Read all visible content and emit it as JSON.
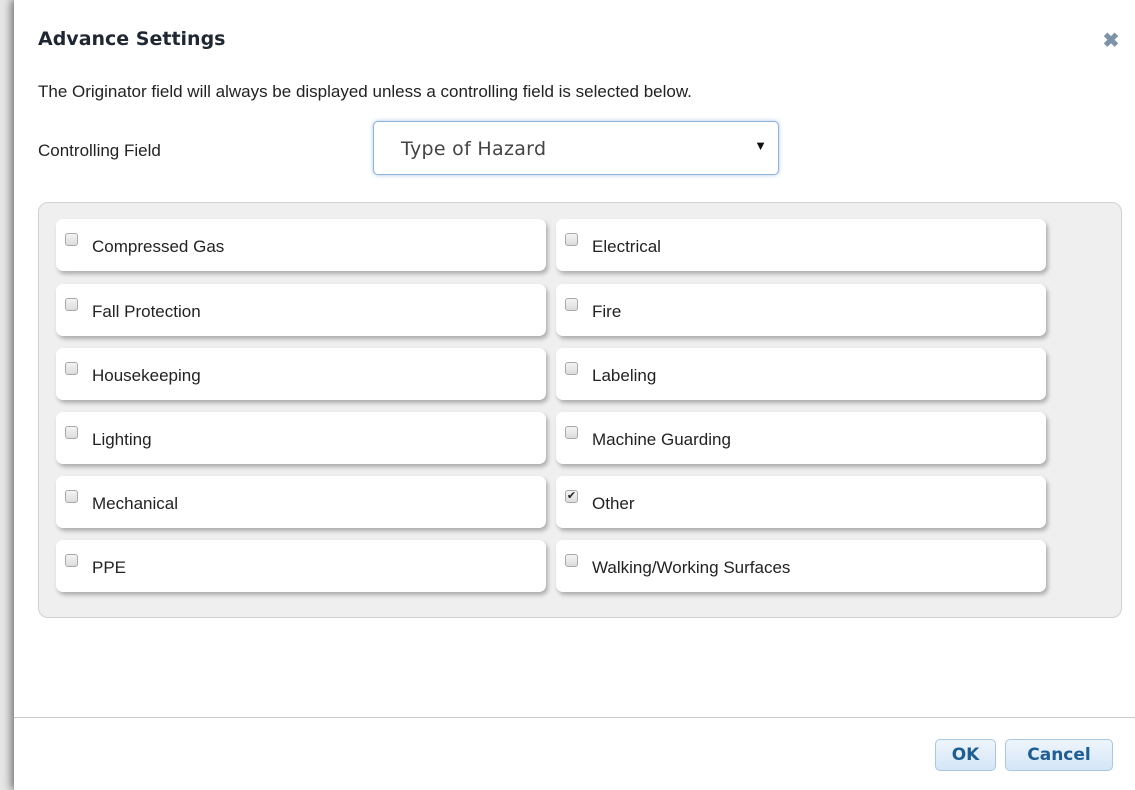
{
  "dialog": {
    "title": "Advance Settings",
    "close_glyph": "✖",
    "description": "The Originator field will always be displayed unless a controlling field is selected below.",
    "controlling_field_label": "Controlling Field",
    "controlling_field_value": "Type of Hazard",
    "select_arrow": "▼"
  },
  "options": [
    {
      "label": "Compressed Gas",
      "checked": false
    },
    {
      "label": "Electrical",
      "checked": false
    },
    {
      "label": "Fall Protection",
      "checked": false
    },
    {
      "label": "Fire",
      "checked": false
    },
    {
      "label": "Housekeeping",
      "checked": false
    },
    {
      "label": "Labeling",
      "checked": false
    },
    {
      "label": "Lighting",
      "checked": false
    },
    {
      "label": "Machine Guarding",
      "checked": false
    },
    {
      "label": "Mechanical",
      "checked": false
    },
    {
      "label": "Other",
      "checked": true
    },
    {
      "label": "PPE",
      "checked": false
    },
    {
      "label": "Walking/Working Surfaces",
      "checked": false
    }
  ],
  "buttons": {
    "ok": "OK",
    "cancel": "Cancel"
  },
  "colors": {
    "accent": "#1f5e93",
    "focus_border": "#8fb3d9",
    "panel_bg": "#efefef"
  },
  "icons": {
    "close": "close-icon",
    "dropdown": "chevron-down-icon",
    "checkbox": "checkbox-icon"
  }
}
